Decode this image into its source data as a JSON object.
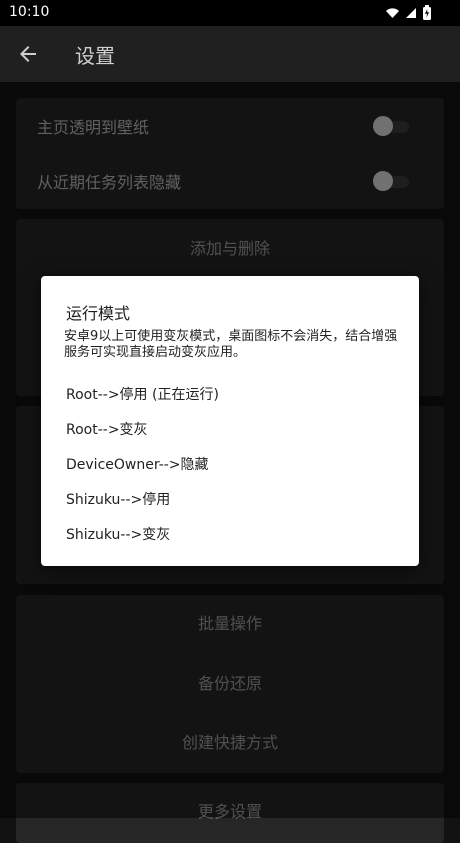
{
  "status_bar": {
    "time": "10:10"
  },
  "app_bar": {
    "title": "设置"
  },
  "settings": [
    {
      "label": "主页透明到壁纸",
      "enabled": false
    },
    {
      "label": "从近期任务列表隐藏",
      "enabled": false
    }
  ],
  "sections": {
    "add_delete": "添加与删除",
    "batch": "批量操作",
    "backup": "备份还原",
    "shortcut": "创建快捷方式",
    "more": "更多设置"
  },
  "dialog": {
    "title": "运行模式",
    "description": "安卓9以上可使用变灰模式，桌面图标不会消失，结合增强服务可实现直接启动变灰应用。",
    "options": [
      "Root-->停用 (正在运行)",
      "Root-->变灰",
      "DeviceOwner-->隐藏",
      "Shizuku-->停用",
      "Shizuku-->变灰"
    ]
  },
  "icons": {
    "back": "arrow-back-icon",
    "wifi": "wifi-icon",
    "signal": "cell-signal-icon",
    "battery": "battery-icon"
  },
  "colors": {
    "background": "#121212",
    "app_bar": "#202020",
    "card": "#262626",
    "dialog": "#ffffff",
    "primary_text": "#b8b8b8",
    "muted_text": "#9a9a9a"
  }
}
